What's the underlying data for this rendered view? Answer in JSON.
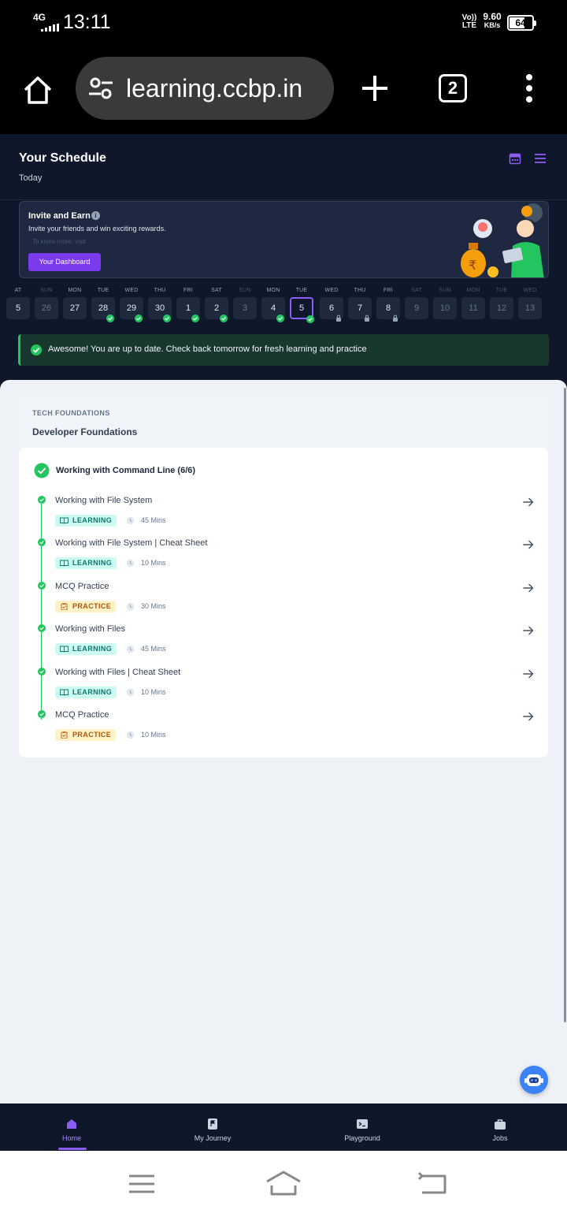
{
  "status_bar": {
    "network": "4G",
    "time": "13:11",
    "volte": [
      "Vo))",
      "LTE"
    ],
    "speed_value": "9.60",
    "speed_unit": "KB/s",
    "battery": "64"
  },
  "browser": {
    "url": "learning.ccbp.in",
    "tab_count": "2"
  },
  "header": {
    "title": "Your Schedule",
    "subtitle": "Today"
  },
  "invite": {
    "title": "Invite and Earn",
    "description": "Invite your friends and win exciting rewards.",
    "hint": "To know more, visit",
    "button": "Your Dashboard"
  },
  "calendar": [
    {
      "day": "AT",
      "date": "5",
      "state": "past"
    },
    {
      "day": "SUN",
      "date": "26",
      "state": "weekend"
    },
    {
      "day": "MON",
      "date": "27",
      "state": "past"
    },
    {
      "day": "TUE",
      "date": "28",
      "state": "done"
    },
    {
      "day": "WED",
      "date": "29",
      "state": "done"
    },
    {
      "day": "THU",
      "date": "30",
      "state": "done"
    },
    {
      "day": "FRI",
      "date": "1",
      "state": "done"
    },
    {
      "day": "SAT",
      "date": "2",
      "state": "done"
    },
    {
      "day": "SUN",
      "date": "3",
      "state": "weekend"
    },
    {
      "day": "MON",
      "date": "4",
      "state": "done"
    },
    {
      "day": "TUE",
      "date": "5",
      "state": "selected"
    },
    {
      "day": "WED",
      "date": "6",
      "state": "locked"
    },
    {
      "day": "THU",
      "date": "7",
      "state": "locked"
    },
    {
      "day": "FRI",
      "date": "8",
      "state": "locked"
    },
    {
      "day": "SAT",
      "date": "9",
      "state": "future"
    },
    {
      "day": "SUN",
      "date": "10",
      "state": "future"
    },
    {
      "day": "MON",
      "date": "11",
      "state": "future"
    },
    {
      "day": "TUE",
      "date": "12",
      "state": "future"
    },
    {
      "day": "WED",
      "date": "13",
      "state": "future"
    }
  ],
  "status_message": "Awesome! You are up to date. Check back tomorrow for fresh learning and practice",
  "course": {
    "category": "TECH FOUNDATIONS",
    "name": "Developer Foundations",
    "topic": "Working with Command Line (6/6)",
    "items": [
      {
        "title": "Working with File System",
        "tag": "LEARNING",
        "duration": "45 Mins"
      },
      {
        "title": "Working with File System | Cheat Sheet",
        "tag": "LEARNING",
        "duration": "10 Mins"
      },
      {
        "title": "MCQ Practice",
        "tag": "PRACTICE",
        "duration": "30 Mins"
      },
      {
        "title": "Working with Files",
        "tag": "LEARNING",
        "duration": "45 Mins"
      },
      {
        "title": "Working with Files | Cheat Sheet",
        "tag": "LEARNING",
        "duration": "10 Mins"
      },
      {
        "title": "MCQ Practice",
        "tag": "PRACTICE",
        "duration": "10 Mins"
      }
    ]
  },
  "app_nav": {
    "home": "Home",
    "journey": "My Journey",
    "playground": "Playground",
    "jobs": "Jobs"
  },
  "colors": {
    "accent": "#8b5cf6",
    "success": "#22c55e",
    "dark_bg": "#0f172a"
  }
}
